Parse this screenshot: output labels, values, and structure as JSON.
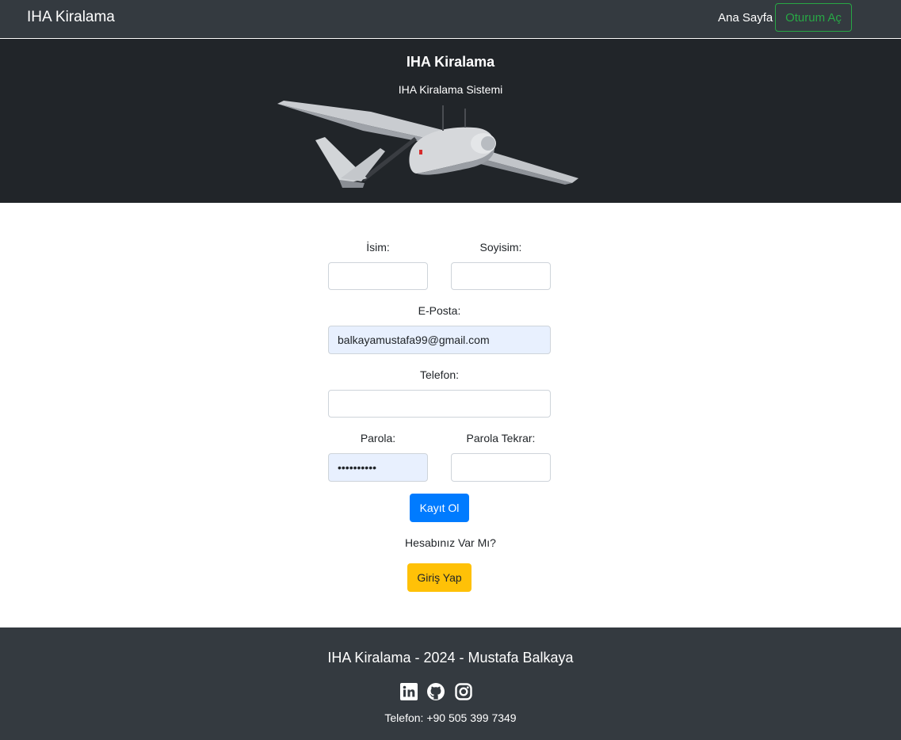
{
  "navbar": {
    "brand": "IHA Kiralama",
    "home_link": "Ana Sayfa",
    "login_button": "Oturum Aç"
  },
  "hero": {
    "title": "IHA Kiralama",
    "subtitle": "IHA Kiralama Sistemi",
    "image_icon": "drone-image"
  },
  "form": {
    "first_name": {
      "label": "İsim:",
      "value": ""
    },
    "last_name": {
      "label": "Soyisim:",
      "value": ""
    },
    "email": {
      "label": "E-Posta:",
      "value": "balkayamustafa99@gmail.com"
    },
    "phone": {
      "label": "Telefon:",
      "value": ""
    },
    "password": {
      "label": "Parola:",
      "value": "••••••••••"
    },
    "password_repeat": {
      "label": "Parola Tekrar:",
      "value": ""
    },
    "register_button": "Kayıt Ol",
    "have_account_text": "Hesabınız Var Mı?",
    "login_button": "Giriş Yap"
  },
  "footer": {
    "title": "IHA Kiralama - 2024 - Mustafa Balkaya",
    "social_icons": [
      "linkedin-icon",
      "github-icon",
      "instagram-icon"
    ],
    "phone": "Telefon: +90 505 399 7349"
  },
  "colors": {
    "navbar_bg": "#343a40",
    "hero_bg": "#212529",
    "success": "#28a745",
    "primary": "#007bff",
    "warning": "#ffc107",
    "autofill_bg": "#e8f0fe"
  }
}
